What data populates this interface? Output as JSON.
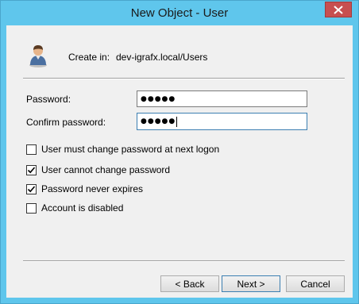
{
  "window": {
    "title": "New Object - User"
  },
  "header": {
    "create_in_label": "Create in:",
    "create_in_path": "dev-igrafx.local/Users"
  },
  "form": {
    "password_label": "Password:",
    "password_value": "●●●●●",
    "confirm_label": "Confirm password:",
    "confirm_value": "●●●●●"
  },
  "options": [
    {
      "label": "User must change password at next logon",
      "checked": false
    },
    {
      "label": "User cannot change password",
      "checked": true
    },
    {
      "label": "Password never expires",
      "checked": true
    },
    {
      "label": "Account is disabled",
      "checked": false
    }
  ],
  "buttons": {
    "back": "< Back",
    "next": "Next >",
    "cancel": "Cancel"
  },
  "icons": {
    "user": "user-icon",
    "close": "close-icon",
    "check": "checkmark-icon"
  },
  "colors": {
    "frame": "#5fc6ec",
    "close": "#c74f50",
    "client": "#f0f0f0"
  }
}
